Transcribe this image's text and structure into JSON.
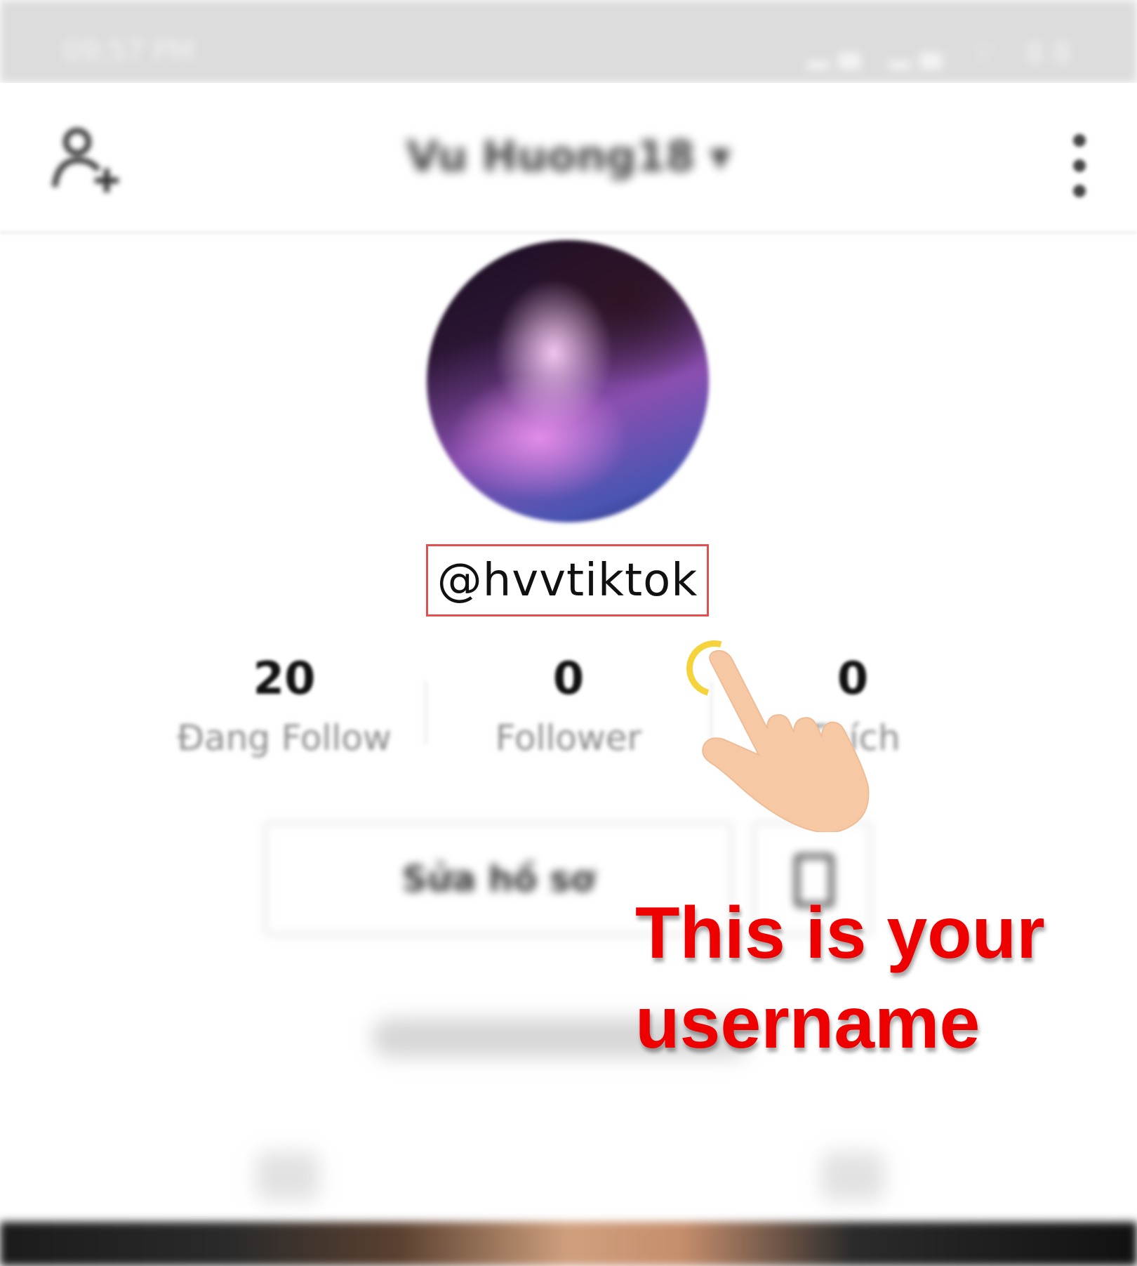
{
  "status_bar": {
    "time": "09:57 PM",
    "icons": "▂▄ ▂▄ ⌔ 88"
  },
  "header": {
    "account_name": "Vu Huong18 ▾"
  },
  "profile": {
    "username": "@hvvtiktok"
  },
  "stats": [
    {
      "value": "20",
      "label": "Đang Follow"
    },
    {
      "value": "0",
      "label": "Follower"
    },
    {
      "value": "0",
      "label": "Thích"
    }
  ],
  "actions": {
    "edit_profile": "Sửa hồ sơ"
  },
  "annotation": {
    "line1": "This is your",
    "line2": "username",
    "color": "#ee0000"
  },
  "icons": [
    "add-user-icon",
    "more-icon",
    "bookmark-icon",
    "hand-pointer-icon",
    "tap-ring-icon"
  ]
}
